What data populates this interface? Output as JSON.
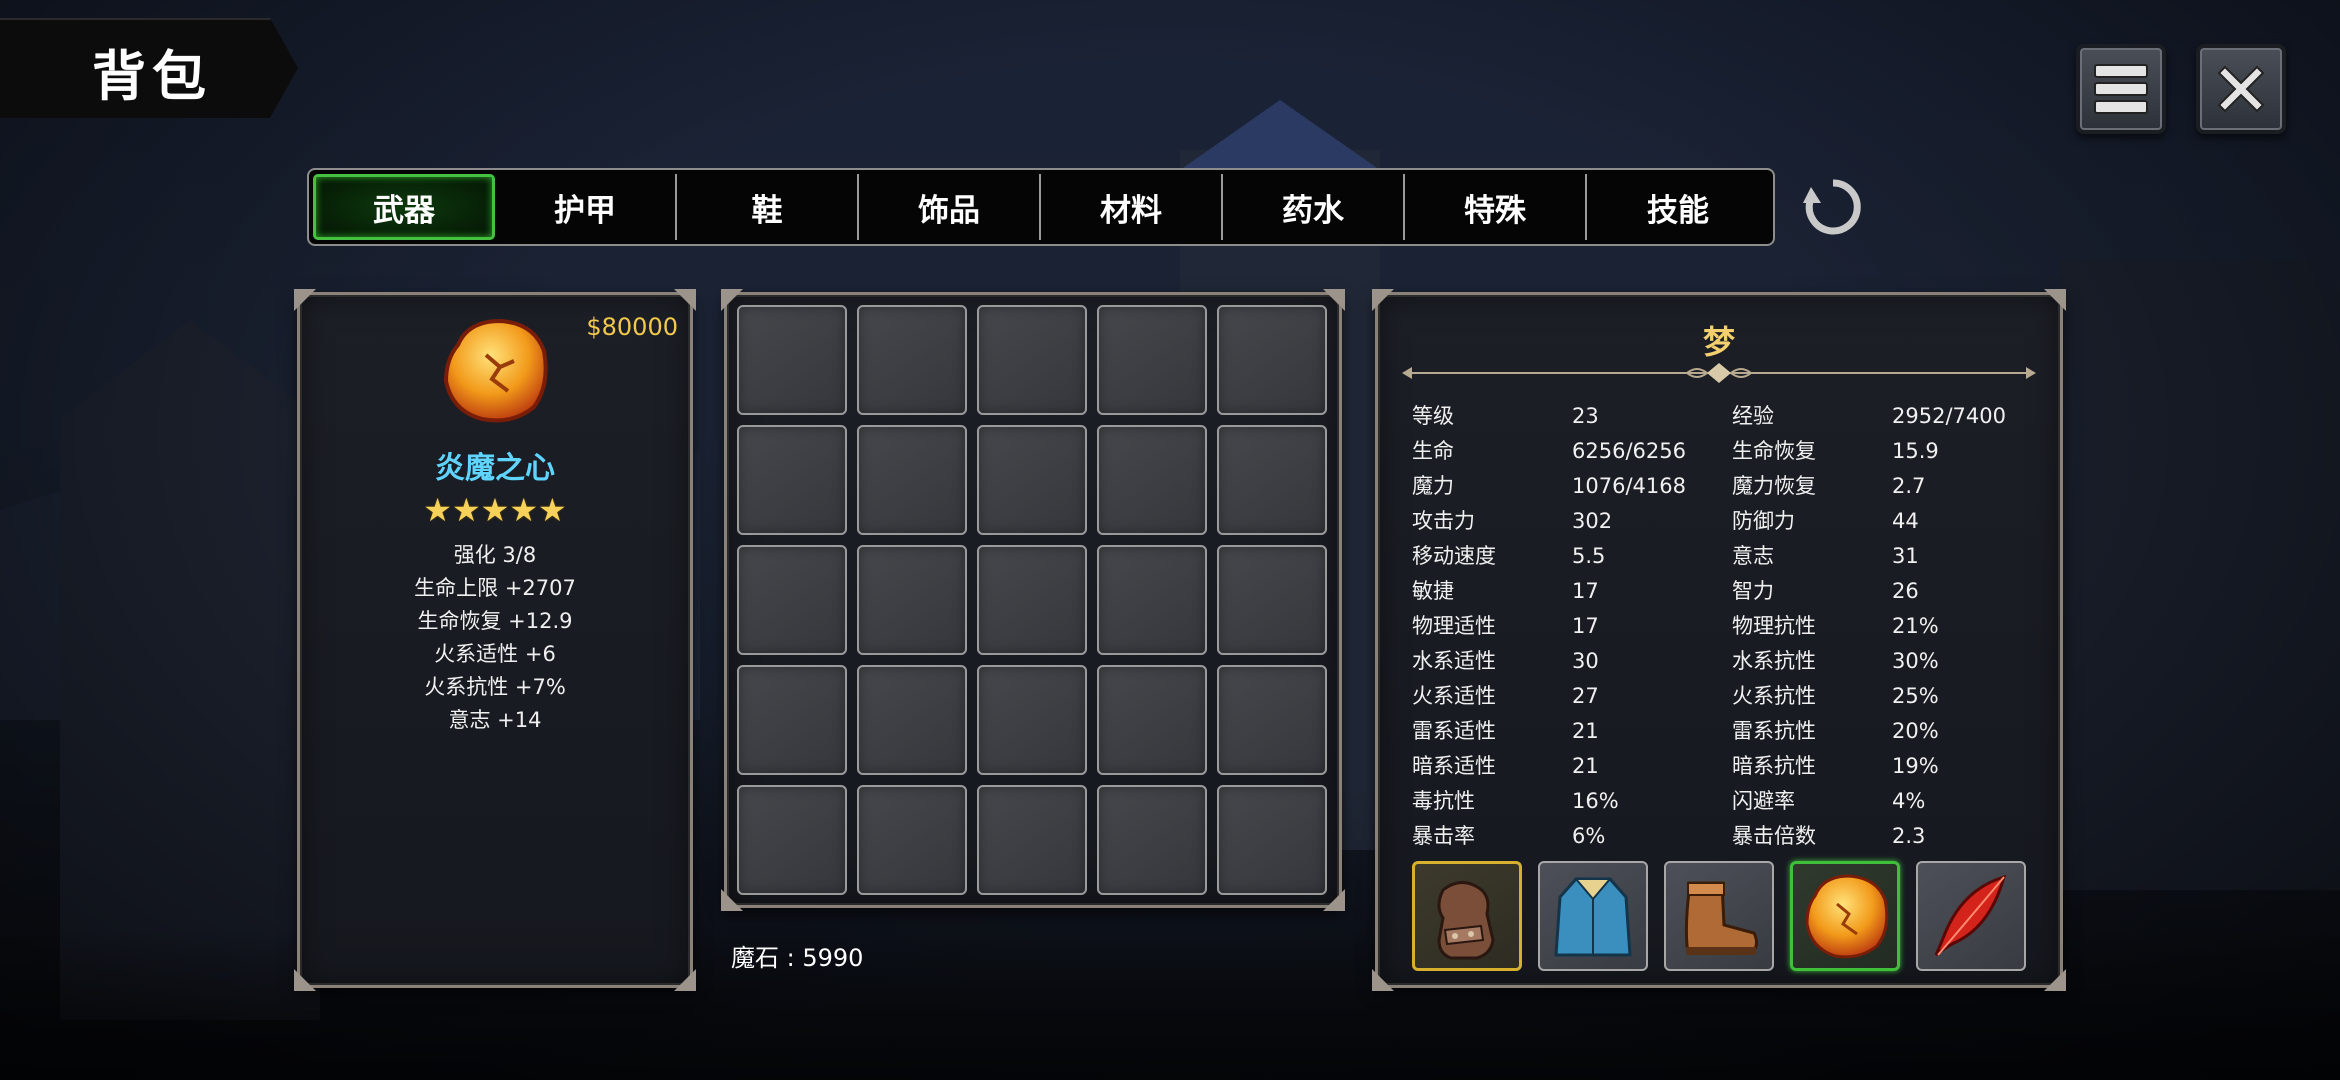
{
  "screen": {
    "title": "背包"
  },
  "tabs": [
    {
      "label": "武器",
      "active": true
    },
    {
      "label": "护甲",
      "active": false
    },
    {
      "label": "鞋",
      "active": false
    },
    {
      "label": "饰品",
      "active": false
    },
    {
      "label": "材料",
      "active": false
    },
    {
      "label": "药水",
      "active": false
    },
    {
      "label": "特殊",
      "active": false
    },
    {
      "label": "技能",
      "active": false
    }
  ],
  "top_buttons": {
    "menu_icon": "menu-icon",
    "close_icon": "close-icon",
    "refresh_icon": "refresh-icon"
  },
  "item": {
    "price": "$80000",
    "icon": "amber-stone-icon",
    "name": "炎魔之心",
    "stars": "★★★★★",
    "star_count": 5,
    "stats": [
      "强化 3/8",
      "生命上限  +2707",
      "生命恢复  +12.9",
      "火系适性  +6",
      "火系抗性  +7%",
      "意志  +14"
    ]
  },
  "inventory": {
    "rows": 5,
    "cols": 5,
    "slots_filled": 0
  },
  "currency": {
    "label": "魔石 : 5990"
  },
  "character": {
    "name": "梦",
    "stats": [
      {
        "label": "等级",
        "value": "23",
        "label2": "经验",
        "value2": "2952/7400"
      },
      {
        "label": "生命",
        "value": "6256/6256",
        "label2": "生命恢复",
        "value2": "15.9"
      },
      {
        "label": "魔力",
        "value": "1076/4168",
        "label2": "魔力恢复",
        "value2": "2.7"
      },
      {
        "label": "攻击力",
        "value": "302",
        "label2": "防御力",
        "value2": "44"
      },
      {
        "label": "移动速度",
        "value": "5.5",
        "label2": "意志",
        "value2": "31"
      },
      {
        "label": "敏捷",
        "value": "17",
        "label2": "智力",
        "value2": "26"
      },
      {
        "label": "物理适性",
        "value": "17",
        "label2": "物理抗性",
        "value2": "21%"
      },
      {
        "label": "水系适性",
        "value": "30",
        "label2": "水系抗性",
        "value2": "30%"
      },
      {
        "label": "火系适性",
        "value": "27",
        "label2": "火系抗性",
        "value2": "25%"
      },
      {
        "label": "雷系适性",
        "value": "21",
        "label2": "雷系抗性",
        "value2": "20%"
      },
      {
        "label": "暗系适性",
        "value": "21",
        "label2": "暗系抗性",
        "value2": "19%"
      },
      {
        "label": "毒抗性",
        "value": "16%",
        "label2": "闪避率",
        "value2": "4%"
      },
      {
        "label": "暴击率",
        "value": "6%",
        "label2": "暴击倍数",
        "value2": "2.3"
      }
    ],
    "equipment": [
      {
        "icon": "gauntlet-icon",
        "frame": "gold"
      },
      {
        "icon": "robe-icon",
        "frame": "normal"
      },
      {
        "icon": "boot-icon",
        "frame": "normal"
      },
      {
        "icon": "amber-stone-icon",
        "frame": "green"
      },
      {
        "icon": "red-feather-icon",
        "frame": "normal"
      }
    ]
  },
  "colors": {
    "active_tab_border": "#45c040",
    "price": "#f2c94c",
    "item_name": "#5fd4ff",
    "stars": "#f7d25a",
    "character_name": "#f3cf6e"
  }
}
